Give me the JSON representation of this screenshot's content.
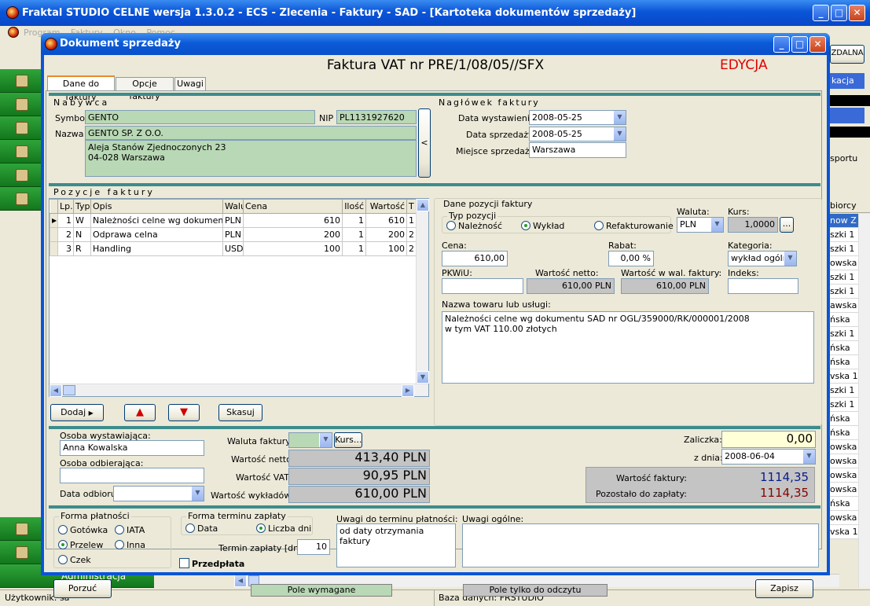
{
  "app": {
    "title": "Fraktal STUDIO CELNE  wersja 1.3.0.2 - ECS - Zlecenia - Faktury - SAD - [Kartoteka dokumentów sprzedaży]",
    "menu": [
      "Program",
      "Faktury",
      "Okno",
      "Pomoc"
    ],
    "right_strip": {
      "button": "ZDALNA",
      "combo": "kacja",
      "label_sportu": "sportu",
      "header": "biorcy",
      "rows": [
        "now Z",
        "szki 1",
        "szki 1",
        "owska",
        "szki 1",
        "szki 1",
        "awska",
        "ńska",
        "szki 1",
        "ńska",
        "ńska",
        "vska 1",
        "szki 1",
        "szki 1",
        "ńska",
        "ńska",
        "owska",
        "owska",
        "owska",
        "owska",
        "ńska",
        "owska",
        "vska 1"
      ]
    },
    "sidebar_admin": "Administracja",
    "status": {
      "user": "Użytkownik: sa",
      "db": "Baza danych: FRSTUDIO"
    }
  },
  "dialog": {
    "title": "Dokument sprzedaży",
    "doc_title": "Faktura VAT nr PRE/1/08/05//SFX",
    "mode": "EDYCJA",
    "tabs": [
      "Dane do faktury",
      "Opcje faktury",
      "Uwagi"
    ],
    "buyer": {
      "section": "Nabywca",
      "symbol_label": "Symbol",
      "symbol": "GENTO",
      "nip_label": "NIP",
      "nip": "PL1131927620",
      "name_label": "Nazwa",
      "name": "GENTO SP. Z O.O.",
      "addr1": "Aleja Stanów Zjednoczonych 23",
      "addr2": "04-028 Warszawa",
      "collapse": "<"
    },
    "header": {
      "section": "Nagłówek faktury",
      "issue_label": "Data wystawienia:",
      "issue": "2008-05-25",
      "sale_label": "Data sprzedaży:",
      "sale": "2008-05-25",
      "place_label": "Miejsce sprzedaży:",
      "place": "Warszawa"
    },
    "items": {
      "section": "Pozycje faktury",
      "columns": [
        "Lp.",
        "Typ",
        "Opis",
        "Walu",
        "Cena",
        "Ilość",
        "Wartość",
        "T"
      ],
      "rows": [
        {
          "lp": "1",
          "typ": "W",
          "opis": "Należności celne wg dokumentu SA",
          "wal": "PLN",
          "cena": "610",
          "ilosc": "1",
          "wartosc": "610",
          "t": "1"
        },
        {
          "lp": "2",
          "typ": "N",
          "opis": "Odprawa celna",
          "wal": "PLN",
          "cena": "200",
          "ilosc": "1",
          "wartosc": "200",
          "t": "2"
        },
        {
          "lp": "3",
          "typ": "R",
          "opis": "Handling",
          "wal": "USD",
          "cena": "100",
          "ilosc": "1",
          "wartosc": "100",
          "t": "2"
        }
      ],
      "add": "Dodaj",
      "delete": "Skasuj"
    },
    "detail": {
      "section": "Dane pozycji faktury",
      "type_group": "Typ pozycji",
      "types": [
        "Należność",
        "Wykład",
        "Refakturowanie"
      ],
      "type_selected": 1,
      "currency_label": "Waluta:",
      "currency": "PLN",
      "rate_label": "Kurs:",
      "rate": "1,0000",
      "rate_btn": "...",
      "price_label": "Cena:",
      "price": "610,00",
      "discount_label": "Rabat:",
      "discount": "0,00 %",
      "category_label": "Kategoria:",
      "category": "wykład ogóln",
      "pkwiu_label": "PKWiU:",
      "pkwiu": "",
      "net_label": "Wartość netto:",
      "net": "610,00 PLN",
      "inv_cur_label": "Wartość w wal. faktury:",
      "inv_cur": "610,00 PLN",
      "index_label": "Indeks:",
      "index": "",
      "goods_label": "Nazwa towaru lub usługi:",
      "goods1": "Należności celne wg dokumentu SAD nr OGL/359000/RK/000001/2008",
      "goods2": "w tym VAT 110.00 złotych"
    },
    "totals": {
      "issuer_label": "Osoba wystawiająca:",
      "issuer": "Anna Kowalska",
      "receiver_label": "Osoba odbierająca:",
      "receiver": "",
      "receipt_label": "Data odbioru:",
      "receipt": "",
      "inv_currency_label": "Waluta faktury:",
      "inv_currency": "",
      "kurs_btn": "Kurs...",
      "net_label": "Wartość netto:",
      "net": "413,40 PLN",
      "vat_label": "Wartość VAT:",
      "vat": "90,95 PLN",
      "outlay_label": "Wartość wykładów:",
      "outlay": "610,00 PLN",
      "advance_label": "Zaliczka:",
      "advance": "0,00",
      "date_label": "z dnia:",
      "date": "2008-06-04",
      "inv_value_label": "Wartość faktury:",
      "inv_value": "1114,35",
      "remaining_label": "Pozostało do zapłaty:",
      "remaining": "1114,35"
    },
    "payment": {
      "form_group": "Forma płatności",
      "forms": [
        "Gotówka",
        "IATA",
        "Przelew",
        "Inna",
        "Czek"
      ],
      "form_selected": "Przelew",
      "term_group": "Forma terminu zapłaty",
      "terms": [
        "Data",
        "Liczba dni"
      ],
      "term_selected": "Liczba dni",
      "term_days_label": "Termin zapłaty [dni]:",
      "term_days": "10",
      "prepay": "Przedpłata",
      "term_notes_label": "Uwagi do terminu płatności:",
      "term_notes": "od daty otrzymania faktury",
      "notes_label": "Uwagi ogólne:",
      "notes": ""
    },
    "footer": {
      "cancel": "Porzuć",
      "required": "Pole wymagane",
      "readonly": "Pole tylko do odczytu",
      "save": "Zapisz"
    },
    "colors": {
      "required": "#b9d8b5",
      "readonly": "#c4c4c4",
      "edit_mode": "#e00000",
      "inv_value": "#0a1a8a",
      "remaining": "#8a0000"
    }
  }
}
